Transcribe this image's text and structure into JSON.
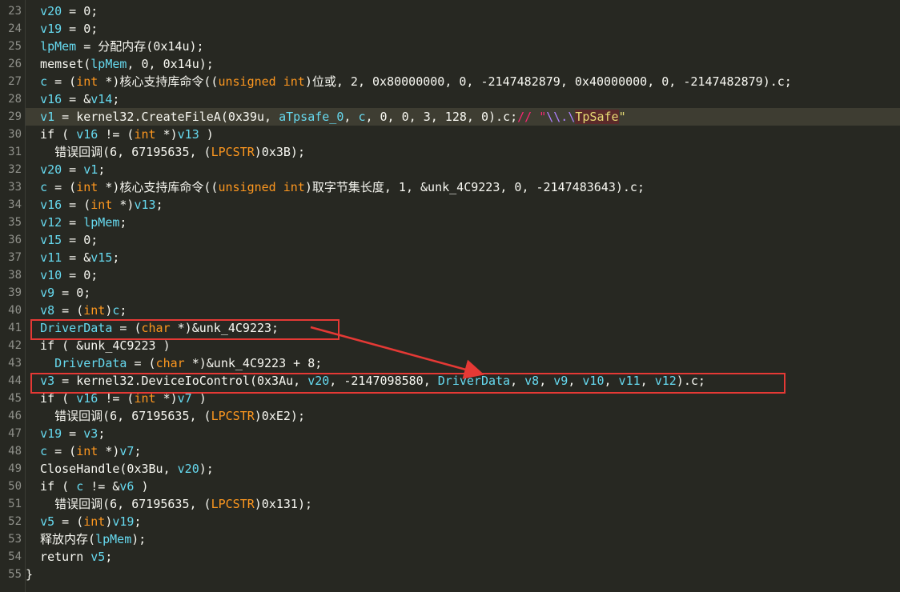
{
  "editor": {
    "lines": [
      {
        "n": "23",
        "segs": [
          [
            "  ",
            "p"
          ],
          [
            "v20",
            "v"
          ],
          [
            " = 0;",
            "p"
          ]
        ]
      },
      {
        "n": "24",
        "segs": [
          [
            "  ",
            "p"
          ],
          [
            "v19",
            "v"
          ],
          [
            " = 0;",
            "p"
          ]
        ]
      },
      {
        "n": "25",
        "segs": [
          [
            "  ",
            "p"
          ],
          [
            "lpMem",
            "v"
          ],
          [
            " = 分配内存(0x14u);",
            "p"
          ]
        ]
      },
      {
        "n": "26",
        "segs": [
          [
            "  memset(",
            "p"
          ],
          [
            "lpMem",
            "v"
          ],
          [
            ", 0, 0x14u);",
            "p"
          ]
        ]
      },
      {
        "n": "27",
        "segs": [
          [
            "  ",
            "p"
          ],
          [
            "c",
            "v"
          ],
          [
            " = (",
            "p"
          ],
          [
            "int",
            "t"
          ],
          [
            " *)核心支持库命令((",
            "p"
          ],
          [
            "unsigned int",
            "t"
          ],
          [
            ")位或, 2, 0x80000000, 0, -2147482879, 0x40000000, 0, -2147482879).c;",
            "p"
          ]
        ]
      },
      {
        "n": "28",
        "segs": [
          [
            "  ",
            "p"
          ],
          [
            "v16",
            "v"
          ],
          [
            " = &",
            "p"
          ],
          [
            "v14",
            "v"
          ],
          [
            ";",
            "p"
          ]
        ]
      },
      {
        "n": "29",
        "cur": true,
        "segs": [
          [
            "  ",
            "p"
          ],
          [
            "v1",
            "v"
          ],
          [
            " = kernel32.CreateFileA(0x39u, ",
            "p"
          ],
          [
            "aTpsafe_0",
            "v"
          ],
          [
            ", ",
            "p"
          ],
          [
            "c",
            "v"
          ],
          [
            ", 0, 0, 3, 128, 0).c;",
            "p"
          ],
          [
            "// \"",
            "c"
          ],
          [
            "\\\\.\\",
            "esc"
          ],
          [
            "TpSafe",
            "hi"
          ],
          [
            "\"",
            "s"
          ]
        ]
      },
      {
        "n": "30",
        "segs": [
          [
            "  if ( ",
            "p"
          ],
          [
            "v16",
            "v"
          ],
          [
            " != (",
            "p"
          ],
          [
            "int",
            "t"
          ],
          [
            " *)",
            "p"
          ],
          [
            "v13",
            "v"
          ],
          [
            " )",
            "p"
          ]
        ]
      },
      {
        "n": "31",
        "segs": [
          [
            "    错误回调(6, 67195635, (",
            "p"
          ],
          [
            "LPCSTR",
            "t"
          ],
          [
            ")0x3B);",
            "p"
          ]
        ]
      },
      {
        "n": "32",
        "segs": [
          [
            "  ",
            "p"
          ],
          [
            "v20",
            "v"
          ],
          [
            " = ",
            "p"
          ],
          [
            "v1",
            "v"
          ],
          [
            ";",
            "p"
          ]
        ]
      },
      {
        "n": "33",
        "segs": [
          [
            "  ",
            "p"
          ],
          [
            "c",
            "v"
          ],
          [
            " = (",
            "p"
          ],
          [
            "int",
            "t"
          ],
          [
            " *)核心支持库命令((",
            "p"
          ],
          [
            "unsigned int",
            "t"
          ],
          [
            ")取字节集长度, 1, &unk_4C9223, 0, -2147483643).c;",
            "p"
          ]
        ]
      },
      {
        "n": "34",
        "segs": [
          [
            "  ",
            "p"
          ],
          [
            "v16",
            "v"
          ],
          [
            " = (",
            "p"
          ],
          [
            "int",
            "t"
          ],
          [
            " *)",
            "p"
          ],
          [
            "v13",
            "v"
          ],
          [
            ";",
            "p"
          ]
        ]
      },
      {
        "n": "35",
        "segs": [
          [
            "  ",
            "p"
          ],
          [
            "v12",
            "v"
          ],
          [
            " = ",
            "p"
          ],
          [
            "lpMem",
            "v"
          ],
          [
            ";",
            "p"
          ]
        ]
      },
      {
        "n": "36",
        "segs": [
          [
            "  ",
            "p"
          ],
          [
            "v15",
            "v"
          ],
          [
            " = 0;",
            "p"
          ]
        ]
      },
      {
        "n": "37",
        "segs": [
          [
            "  ",
            "p"
          ],
          [
            "v11",
            "v"
          ],
          [
            " = &",
            "p"
          ],
          [
            "v15",
            "v"
          ],
          [
            ";",
            "p"
          ]
        ]
      },
      {
        "n": "38",
        "segs": [
          [
            "  ",
            "p"
          ],
          [
            "v10",
            "v"
          ],
          [
            " = 0;",
            "p"
          ]
        ]
      },
      {
        "n": "39",
        "segs": [
          [
            "  ",
            "p"
          ],
          [
            "v9",
            "v"
          ],
          [
            " = 0;",
            "p"
          ]
        ]
      },
      {
        "n": "40",
        "segs": [
          [
            "  ",
            "p"
          ],
          [
            "v8",
            "v"
          ],
          [
            " = (",
            "p"
          ],
          [
            "int",
            "t"
          ],
          [
            ")",
            "p"
          ],
          [
            "c",
            "v"
          ],
          [
            ";",
            "p"
          ]
        ]
      },
      {
        "n": "41",
        "segs": [
          [
            "  ",
            "p"
          ],
          [
            "DriverData",
            "v"
          ],
          [
            " = (",
            "p"
          ],
          [
            "char",
            "t"
          ],
          [
            " *)&unk_4C9223;",
            "p"
          ]
        ]
      },
      {
        "n": "42",
        "segs": [
          [
            "  if ( &unk_4C9223 )",
            "p"
          ]
        ]
      },
      {
        "n": "43",
        "segs": [
          [
            "    ",
            "p"
          ],
          [
            "DriverData",
            "v"
          ],
          [
            " = (",
            "p"
          ],
          [
            "char",
            "t"
          ],
          [
            " *)&unk_4C9223 + 8;",
            "p"
          ]
        ]
      },
      {
        "n": "44",
        "segs": [
          [
            "  ",
            "p"
          ],
          [
            "v3",
            "v"
          ],
          [
            " = kernel32.DeviceIoControl(0x3Au, ",
            "p"
          ],
          [
            "v20",
            "v"
          ],
          [
            ", -2147098580, ",
            "p"
          ],
          [
            "DriverData",
            "v"
          ],
          [
            ", ",
            "p"
          ],
          [
            "v8",
            "v"
          ],
          [
            ", ",
            "p"
          ],
          [
            "v9",
            "v"
          ],
          [
            ", ",
            "p"
          ],
          [
            "v10",
            "v"
          ],
          [
            ", ",
            "p"
          ],
          [
            "v11",
            "v"
          ],
          [
            ", ",
            "p"
          ],
          [
            "v12",
            "v"
          ],
          [
            ").c;",
            "p"
          ]
        ]
      },
      {
        "n": "45",
        "segs": [
          [
            "  if ( ",
            "p"
          ],
          [
            "v16",
            "v"
          ],
          [
            " != (",
            "p"
          ],
          [
            "int",
            "t"
          ],
          [
            " *)",
            "p"
          ],
          [
            "v7",
            "v"
          ],
          [
            " )",
            "p"
          ]
        ]
      },
      {
        "n": "46",
        "segs": [
          [
            "    错误回调(6, 67195635, (",
            "p"
          ],
          [
            "LPCSTR",
            "t"
          ],
          [
            ")0xE2);",
            "p"
          ]
        ]
      },
      {
        "n": "47",
        "segs": [
          [
            "  ",
            "p"
          ],
          [
            "v19",
            "v"
          ],
          [
            " = ",
            "p"
          ],
          [
            "v3",
            "v"
          ],
          [
            ";",
            "p"
          ]
        ]
      },
      {
        "n": "48",
        "segs": [
          [
            "  ",
            "p"
          ],
          [
            "c",
            "v"
          ],
          [
            " = (",
            "p"
          ],
          [
            "int",
            "t"
          ],
          [
            " *)",
            "p"
          ],
          [
            "v7",
            "v"
          ],
          [
            ";",
            "p"
          ]
        ]
      },
      {
        "n": "49",
        "segs": [
          [
            "  CloseHandle(0x3Bu, ",
            "p"
          ],
          [
            "v20",
            "v"
          ],
          [
            ");",
            "p"
          ]
        ]
      },
      {
        "n": "50",
        "segs": [
          [
            "  if ( ",
            "p"
          ],
          [
            "c",
            "v"
          ],
          [
            " != &",
            "p"
          ],
          [
            "v6",
            "v"
          ],
          [
            " )",
            "p"
          ]
        ]
      },
      {
        "n": "51",
        "segs": [
          [
            "    错误回调(6, 67195635, (",
            "p"
          ],
          [
            "LPCSTR",
            "t"
          ],
          [
            ")0x131);",
            "p"
          ]
        ]
      },
      {
        "n": "52",
        "segs": [
          [
            "  ",
            "p"
          ],
          [
            "v5",
            "v"
          ],
          [
            " = (",
            "p"
          ],
          [
            "int",
            "t"
          ],
          [
            ")",
            "p"
          ],
          [
            "v19",
            "v"
          ],
          [
            ";",
            "p"
          ]
        ]
      },
      {
        "n": "53",
        "segs": [
          [
            "  释放内存(",
            "p"
          ],
          [
            "lpMem",
            "v"
          ],
          [
            ");",
            "p"
          ]
        ]
      },
      {
        "n": "54",
        "segs": [
          [
            "  return ",
            "p"
          ],
          [
            "v5",
            "v"
          ],
          [
            ";",
            "p"
          ]
        ]
      },
      {
        "n": "55",
        "segs": [
          [
            "}",
            "p"
          ]
        ]
      }
    ]
  },
  "annotations": {
    "box1_target": "DriverData = (char *)&unk_4C9223;",
    "box2_target": "v3 = kernel32.DeviceIoControl(0x3Au, v20, -2147098580, DriverData, v8, v9, v10, v11, v12).c;",
    "color": "#e53935"
  }
}
